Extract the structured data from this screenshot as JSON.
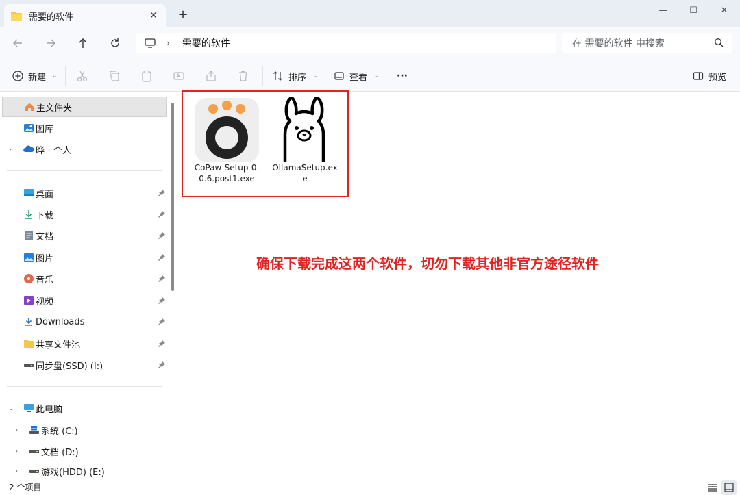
{
  "window": {
    "tab_title": "需要的软件",
    "new_tab": "+"
  },
  "nav": {
    "breadcrumb": "需要的软件",
    "search_placeholder": "在 需要的软件 中搜索"
  },
  "toolbar": {
    "new_label": "新建",
    "sort_label": "排序",
    "view_label": "查看",
    "more_label": "···",
    "preview_label": "预览"
  },
  "sidebar": {
    "top_items": [
      {
        "label": "主文件夹",
        "icon": "home-icon"
      },
      {
        "label": "图库",
        "icon": "gallery-icon"
      },
      {
        "label": "晔 - 个人",
        "icon": "onedrive-icon"
      }
    ],
    "quick_access": [
      {
        "label": "桌面",
        "icon": "desktop-icon"
      },
      {
        "label": "下载",
        "icon": "download-icon"
      },
      {
        "label": "文档",
        "icon": "document-icon"
      },
      {
        "label": "图片",
        "icon": "pictures-icon"
      },
      {
        "label": "音乐",
        "icon": "music-icon"
      },
      {
        "label": "视频",
        "icon": "video-icon"
      },
      {
        "label": "Downloads",
        "icon": "download-folder-icon"
      },
      {
        "label": "共享文件池",
        "icon": "folder-icon"
      },
      {
        "label": "同步盘(SSD) (I:)",
        "icon": "drive-icon"
      }
    ],
    "this_pc": {
      "label": "此电脑",
      "drives": [
        {
          "label": "系统 (C:)"
        },
        {
          "label": "文档 (D:)"
        },
        {
          "label": "游戏(HDD) (E:)"
        }
      ]
    }
  },
  "files": [
    {
      "name_line1": "CoPaw-Setup-0.",
      "name_line2": "0.6.post1.exe",
      "icon": "copaw-app-icon"
    },
    {
      "name_line1": "OllamaSetup.ex",
      "name_line2": "e",
      "icon": "ollama-llama-icon"
    }
  ],
  "annotation": "确保下载完成这两个软件，切勿下载其他非官方途径软件",
  "status": {
    "item_count": "2 个项目"
  },
  "colors": {
    "accent_red": "#e02424",
    "copaw_orange": "#f4a04b"
  }
}
